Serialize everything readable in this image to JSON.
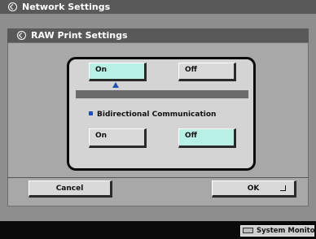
{
  "window_title": "Network Settings",
  "dialog_title": "RAW Print Settings",
  "raw_print": {
    "on_label": "On",
    "off_label": "Off",
    "selected": "On"
  },
  "bidirectional": {
    "label": "Bidirectional Communication",
    "on_label": "On",
    "off_label": "Off",
    "selected": "Off"
  },
  "footer": {
    "cancel_label": "Cancel",
    "ok_label": "OK"
  },
  "status_bar": {
    "system_monitor_label": "System Monitor"
  },
  "icons": {
    "title": "settings-return-icon",
    "selection_marker": "blue-triangle-icon",
    "ok": "enter-icon",
    "system_monitor": "monitor-icon"
  },
  "colors": {
    "selected_button": "#b8f0e6",
    "accent_blue": "#1d4fb5",
    "title_bar": "#595959"
  }
}
